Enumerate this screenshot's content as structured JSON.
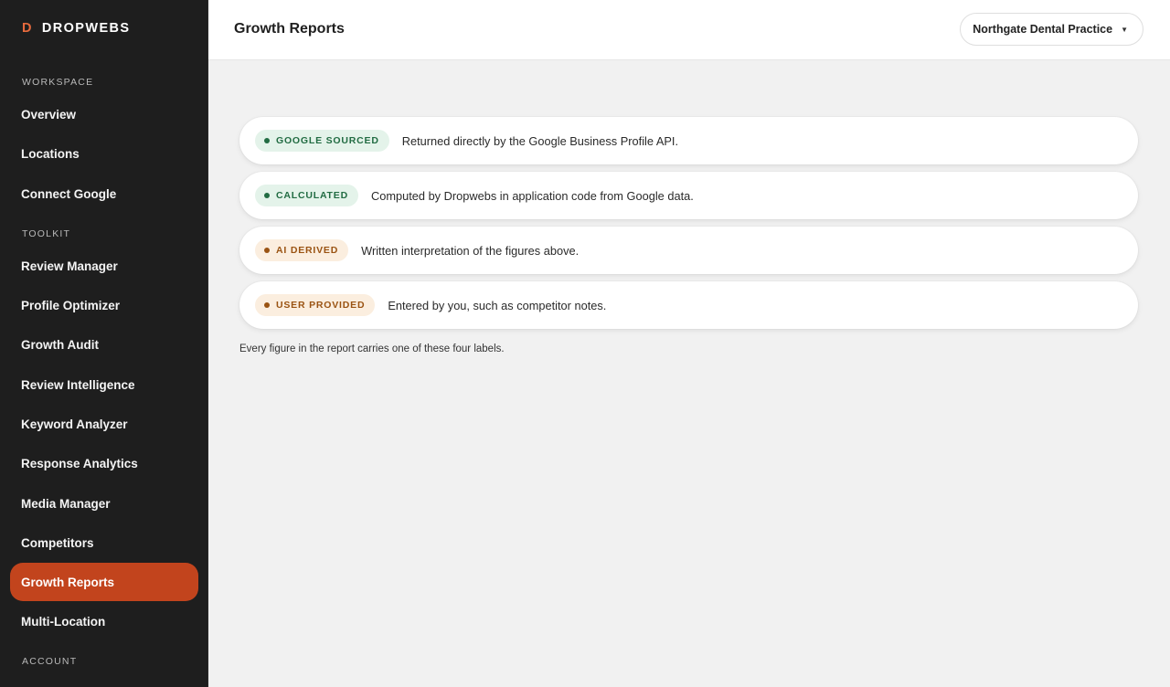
{
  "brand": {
    "mark": "D",
    "name": "DROPWEBS"
  },
  "sidebar": {
    "sections": [
      {
        "label": "WORKSPACE"
      },
      {
        "label": "TOOLKIT"
      },
      {
        "label": "ACCOUNT"
      }
    ],
    "items": [
      {
        "label": "Overview"
      },
      {
        "label": "Locations"
      },
      {
        "label": "Connect Google"
      },
      {
        "label": "Review Manager"
      },
      {
        "label": "Profile Optimizer"
      },
      {
        "label": "Growth Audit"
      },
      {
        "label": "Review Intelligence"
      },
      {
        "label": "Keyword Analyzer"
      },
      {
        "label": "Response Analytics"
      },
      {
        "label": "Media Manager"
      },
      {
        "label": "Competitors"
      },
      {
        "label": "Growth Reports",
        "active": true
      },
      {
        "label": "Multi-Location"
      }
    ]
  },
  "header": {
    "title": "Growth Reports",
    "location_selector": {
      "value": "Northgate Dental Practice",
      "icon": "caret-down-icon"
    }
  },
  "legend": [
    {
      "badge": "GOOGLE SOURCED",
      "tone": "green",
      "description": "Returned directly by the Google Business Profile API."
    },
    {
      "badge": "CALCULATED",
      "tone": "green",
      "description": "Computed by Dropwebs in application code from Google data."
    },
    {
      "badge": "AI DERIVED",
      "tone": "amber",
      "description": "Written interpretation of the figures above."
    },
    {
      "badge": "USER PROVIDED",
      "tone": "amber",
      "description": "Entered by you, such as competitor notes."
    }
  ],
  "footnote": "Every figure in the report carries one of these four labels.",
  "colors": {
    "sidebar_bg": "#1e1e1e",
    "accent": "#c2441d",
    "brand_mark": "#e76a3d",
    "green_badge_bg": "#e4f3ea",
    "green_badge_text": "#226c43",
    "amber_badge_bg": "#fbeedf",
    "amber_badge_text": "#9a5312",
    "main_bg": "#f1f1f1"
  }
}
